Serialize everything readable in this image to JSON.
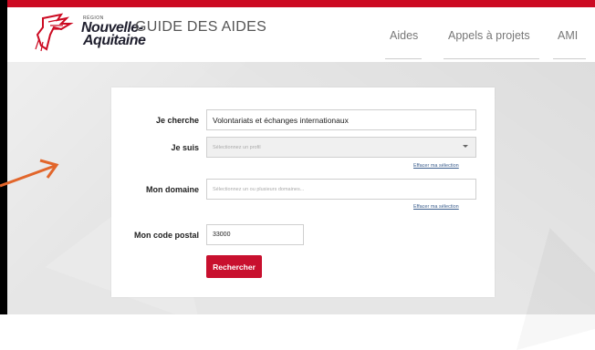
{
  "header": {
    "logo_region": "RÉGION",
    "logo_line1": "Nouvelle-",
    "logo_line2": "Aquitaine",
    "title": "GUIDE DES AIDES",
    "nav": [
      "Aides",
      "Appels à projets",
      "AMI"
    ]
  },
  "form": {
    "search_label": "Je cherche",
    "search_value": "Volontariats et échanges internationaux",
    "profile_label": "Je suis",
    "profile_placeholder": "Sélectionnez un profil",
    "profile_clear": "Effacer ma sélection",
    "domain_label": "Mon domaine",
    "domain_placeholder": "Sélectionnez un ou plusieurs domaines...",
    "domain_clear": "Effacer ma sélection",
    "postal_label": "Mon code postal",
    "postal_value": "33000",
    "submit_label": "Rechercher"
  },
  "colors": {
    "brand_red": "#c8102e",
    "annotation_arrow": "#e2662b"
  }
}
